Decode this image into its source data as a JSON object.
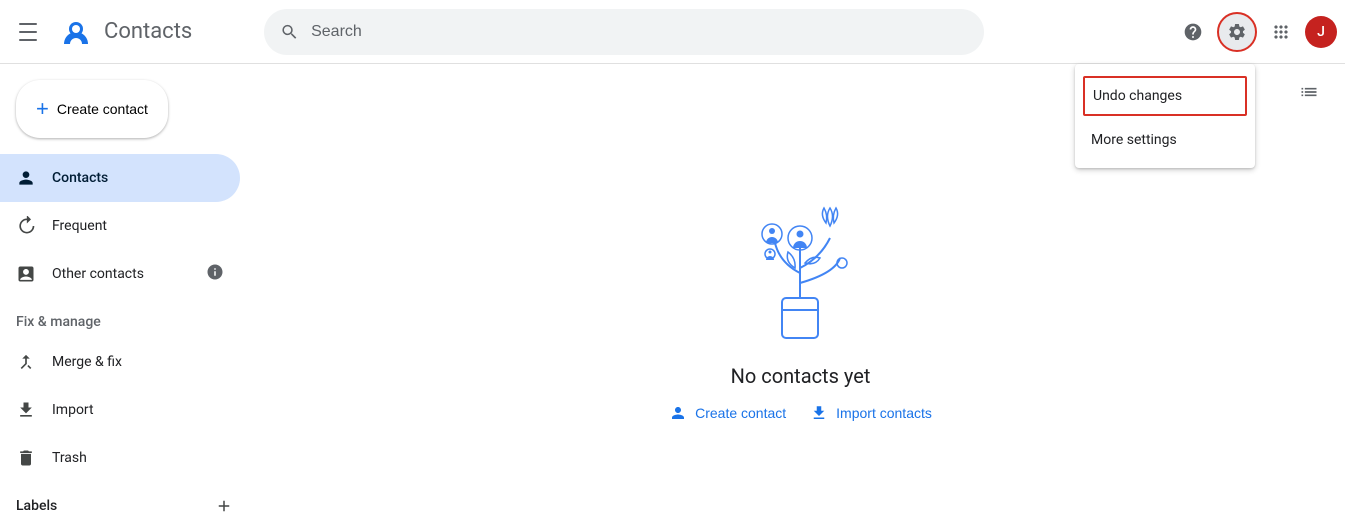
{
  "header": {
    "menu_label": "Main menu",
    "app_name": "Contacts",
    "search_placeholder": "Search",
    "help_label": "Help",
    "settings_label": "Settings",
    "apps_label": "Google apps",
    "avatar_label": "J"
  },
  "sidebar": {
    "create_button": "Create contact",
    "nav_items": [
      {
        "id": "contacts",
        "label": "Contacts",
        "icon": "person",
        "active": true
      },
      {
        "id": "frequent",
        "label": "Frequent",
        "icon": "history"
      },
      {
        "id": "other-contacts",
        "label": "Other contacts",
        "icon": "inbox",
        "has_info": true
      }
    ],
    "fix_manage_title": "Fix & manage",
    "fix_manage_items": [
      {
        "id": "merge",
        "label": "Merge & fix",
        "icon": "merge"
      },
      {
        "id": "import",
        "label": "Import",
        "icon": "download"
      },
      {
        "id": "trash",
        "label": "Trash",
        "icon": "trash"
      }
    ],
    "labels_title": "Labels",
    "add_label_tooltip": "Add label"
  },
  "main": {
    "list_icon": "list",
    "empty_text": "No contacts yet",
    "create_link": "Create contact",
    "import_link": "Import contacts"
  },
  "dropdown": {
    "items": [
      {
        "id": "undo-changes",
        "label": "Undo changes",
        "highlighted": true
      },
      {
        "id": "more-settings",
        "label": "More settings",
        "highlighted": false
      }
    ]
  }
}
